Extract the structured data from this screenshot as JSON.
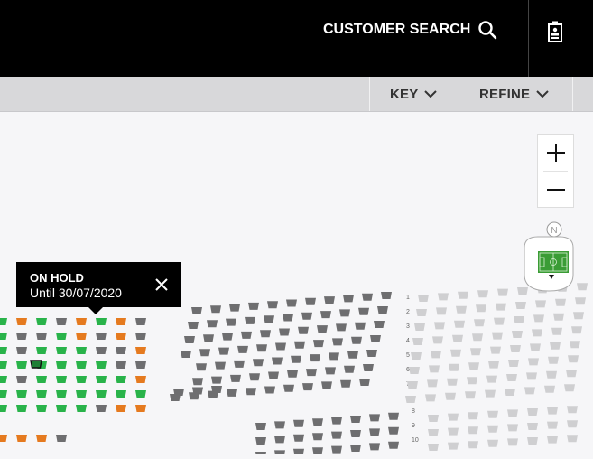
{
  "header": {
    "customer_search_label": "CUSTOMER SEARCH",
    "search_icon": "search-icon",
    "badge_icon": "id-badge-icon"
  },
  "toolbar": {
    "key_label": "KEY",
    "refine_label": "REFINE"
  },
  "map_controls": {
    "zoom_in_icon": "plus-icon",
    "zoom_out_icon": "minus-icon",
    "compass_label": "N"
  },
  "tooltip": {
    "title": "ON HOLD",
    "subtitle": "Until 30/07/2020"
  },
  "row_labels": {
    "upper_block": [
      "1",
      "2",
      "3",
      "4",
      "5",
      "6",
      "7"
    ],
    "lower_block": [
      "8",
      "9",
      "10"
    ]
  },
  "colors": {
    "available": "#29b34a",
    "on_hold": "#e57a1f",
    "unavailable": "#6e6e70",
    "distant": "#cfcfd1",
    "header_bg": "#000000",
    "toolbar_bg": "#d8d8da"
  }
}
